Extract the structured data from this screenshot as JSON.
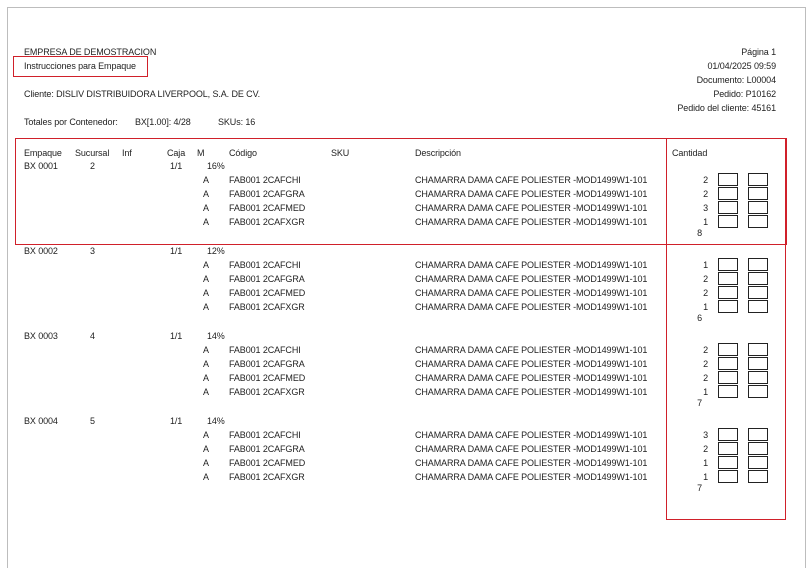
{
  "header": {
    "company": "EMPRESA DE DEMOSTRACION",
    "title": "Instrucciones para Empaque",
    "client": "Cliente: DISLIV  DISTRIBUIDORA LIVERPOOL, S.A. DE CV.",
    "totals": "Totales por Contenedor:",
    "totals_bx": "BX[1.00]: 4/28",
    "totals_skus": "SKUs: 16",
    "page": "Página 1",
    "datetime": "01/04/2025  09:59",
    "document": "Documento: L00004",
    "order": "Pedido: P10162",
    "client_order": "Pedido del cliente: 45161"
  },
  "columns": {
    "empaque": "Empaque",
    "sucursal": "Sucursal",
    "inf": "Inf",
    "caja": "Caja",
    "m": "M",
    "codigo": "Código",
    "sku": "SKU",
    "descripcion": "Descripción",
    "cantidad": "Cantidad"
  },
  "groups": [
    {
      "empaque": "BX  0001",
      "sucursal": "2",
      "caja": "1/1",
      "pct": "16%",
      "total": "8",
      "items": [
        {
          "m": "A",
          "codigo": "FAB001 2CAFCHI",
          "desc": "CHAMARRA DAMA CAFE POLIESTER  -MOD1499W1-101",
          "qty": "2"
        },
        {
          "m": "A",
          "codigo": "FAB001 2CAFGRA",
          "desc": "CHAMARRA DAMA CAFE POLIESTER  -MOD1499W1-101",
          "qty": "2"
        },
        {
          "m": "A",
          "codigo": "FAB001 2CAFMED",
          "desc": "CHAMARRA DAMA CAFE POLIESTER  -MOD1499W1-101",
          "qty": "3"
        },
        {
          "m": "A",
          "codigo": "FAB001 2CAFXGR",
          "desc": "CHAMARRA DAMA CAFE POLIESTER  -MOD1499W1-101",
          "qty": "1"
        }
      ]
    },
    {
      "empaque": "BX  0002",
      "sucursal": "3",
      "caja": "1/1",
      "pct": "12%",
      "total": "6",
      "items": [
        {
          "m": "A",
          "codigo": "FAB001 2CAFCHI",
          "desc": "CHAMARRA DAMA CAFE POLIESTER  -MOD1499W1-101",
          "qty": "1"
        },
        {
          "m": "A",
          "codigo": "FAB001 2CAFGRA",
          "desc": "CHAMARRA DAMA CAFE POLIESTER  -MOD1499W1-101",
          "qty": "2"
        },
        {
          "m": "A",
          "codigo": "FAB001 2CAFMED",
          "desc": "CHAMARRA DAMA CAFE POLIESTER  -MOD1499W1-101",
          "qty": "2"
        },
        {
          "m": "A",
          "codigo": "FAB001 2CAFXGR",
          "desc": "CHAMARRA DAMA CAFE POLIESTER  -MOD1499W1-101",
          "qty": "1"
        }
      ]
    },
    {
      "empaque": "BX  0003",
      "sucursal": "4",
      "caja": "1/1",
      "pct": "14%",
      "total": "7",
      "items": [
        {
          "m": "A",
          "codigo": "FAB001 2CAFCHI",
          "desc": "CHAMARRA DAMA CAFE POLIESTER  -MOD1499W1-101",
          "qty": "2"
        },
        {
          "m": "A",
          "codigo": "FAB001 2CAFGRA",
          "desc": "CHAMARRA DAMA CAFE POLIESTER  -MOD1499W1-101",
          "qty": "2"
        },
        {
          "m": "A",
          "codigo": "FAB001 2CAFMED",
          "desc": "CHAMARRA DAMA CAFE POLIESTER  -MOD1499W1-101",
          "qty": "2"
        },
        {
          "m": "A",
          "codigo": "FAB001 2CAFXGR",
          "desc": "CHAMARRA DAMA CAFE POLIESTER  -MOD1499W1-101",
          "qty": "1"
        }
      ]
    },
    {
      "empaque": "BX  0004",
      "sucursal": "5",
      "caja": "1/1",
      "pct": "14%",
      "total": "7",
      "items": [
        {
          "m": "A",
          "codigo": "FAB001 2CAFCHI",
          "desc": "CHAMARRA DAMA CAFE POLIESTER  -MOD1499W1-101",
          "qty": "3"
        },
        {
          "m": "A",
          "codigo": "FAB001 2CAFGRA",
          "desc": "CHAMARRA DAMA CAFE POLIESTER  -MOD1499W1-101",
          "qty": "2"
        },
        {
          "m": "A",
          "codigo": "FAB001 2CAFMED",
          "desc": "CHAMARRA DAMA CAFE POLIESTER  -MOD1499W1-101",
          "qty": "1"
        },
        {
          "m": "A",
          "codigo": "FAB001 2CAFXGR",
          "desc": "CHAMARRA DAMA CAFE POLIESTER  -MOD1499W1-101",
          "qty": "1"
        }
      ]
    }
  ]
}
